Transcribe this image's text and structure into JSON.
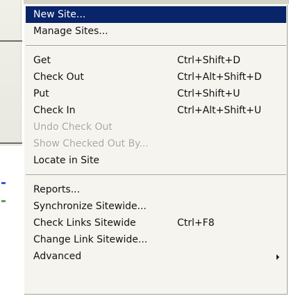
{
  "menu": {
    "groups": [
      {
        "items": [
          {
            "label": "New Site...",
            "shortcut": "",
            "state": "highlighted"
          },
          {
            "label": "Manage Sites...",
            "shortcut": "",
            "state": "enabled"
          }
        ]
      },
      {
        "items": [
          {
            "label": "Get",
            "shortcut": "Ctrl+Shift+D",
            "state": "enabled"
          },
          {
            "label": "Check Out",
            "shortcut": "Ctrl+Alt+Shift+D",
            "state": "enabled"
          },
          {
            "label": "Put",
            "shortcut": "Ctrl+Shift+U",
            "state": "enabled"
          },
          {
            "label": "Check In",
            "shortcut": "Ctrl+Alt+Shift+U",
            "state": "enabled"
          },
          {
            "label": "Undo Check Out",
            "shortcut": "",
            "state": "disabled"
          },
          {
            "label": "Show Checked Out By...",
            "shortcut": "",
            "state": "disabled"
          },
          {
            "label": "Locate in Site",
            "shortcut": "",
            "state": "enabled"
          }
        ]
      },
      {
        "items": [
          {
            "label": "Reports...",
            "shortcut": "",
            "state": "enabled"
          },
          {
            "label": "Synchronize Sitewide...",
            "shortcut": "",
            "state": "enabled"
          },
          {
            "label": "Check Links Sitewide",
            "shortcut": "Ctrl+F8",
            "state": "enabled"
          },
          {
            "label": "Change Link Sitewide...",
            "shortcut": "",
            "state": "enabled"
          },
          {
            "label": "Advanced",
            "shortcut": "",
            "state": "enabled",
            "submenu_icon": "submenu-arrow-icon"
          }
        ]
      }
    ]
  },
  "colors": {
    "menu_background": "#f5f4ef",
    "highlight_background": "#0a246a",
    "highlight_text": "#ffffff",
    "disabled_text": "#a7a6a0"
  }
}
